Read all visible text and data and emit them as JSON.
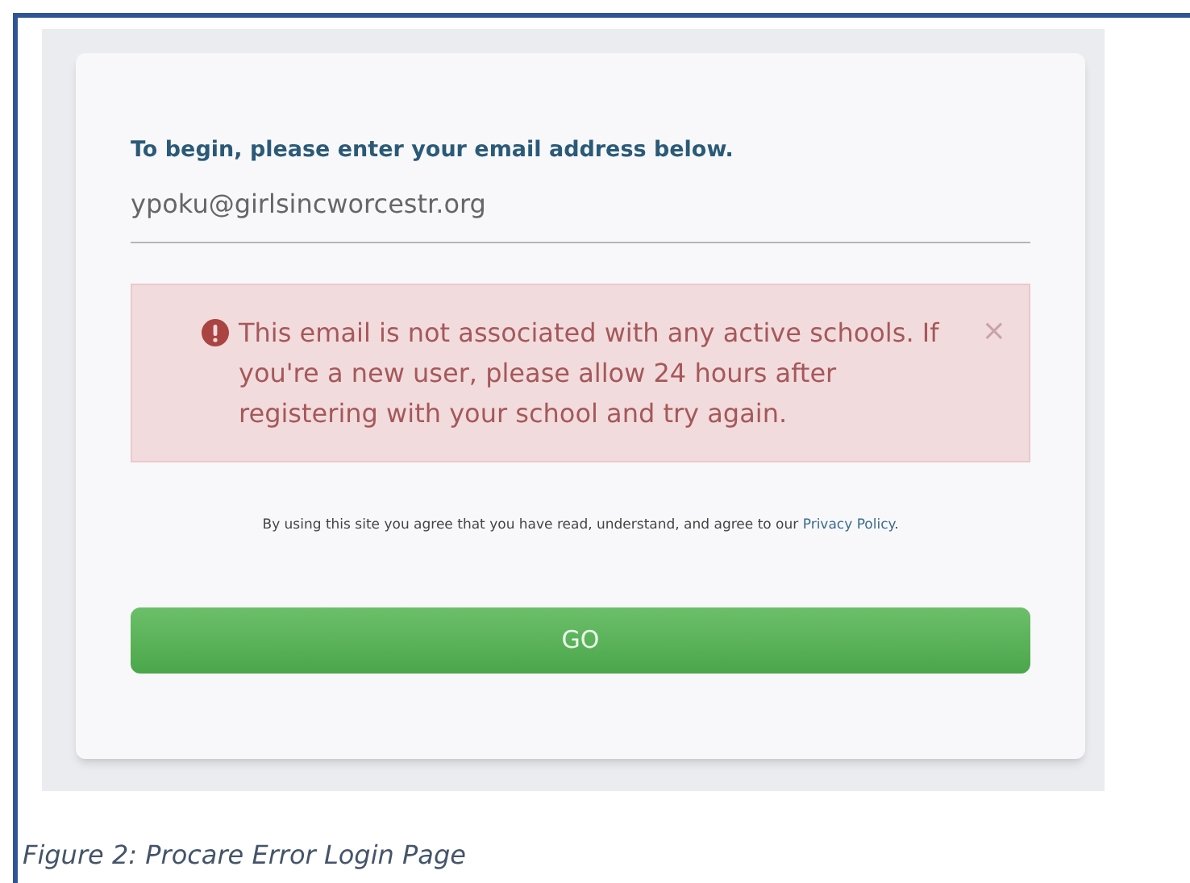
{
  "form": {
    "heading": "To begin, please enter your email address below.",
    "email": {
      "value": "ypoku@girlsincworcestr.org"
    },
    "alert": {
      "message": "This email is not associated with any active schools. If you're a new user, please allow 24 hours after registering with your school and try again.",
      "close": "×"
    },
    "terms": {
      "text": "By using this site you agree that you have read, understand, and agree to our",
      "link": "Privacy Policy",
      "end": "."
    },
    "button": "GO"
  },
  "caption": "Figure 2: Procare Error Login Page"
}
